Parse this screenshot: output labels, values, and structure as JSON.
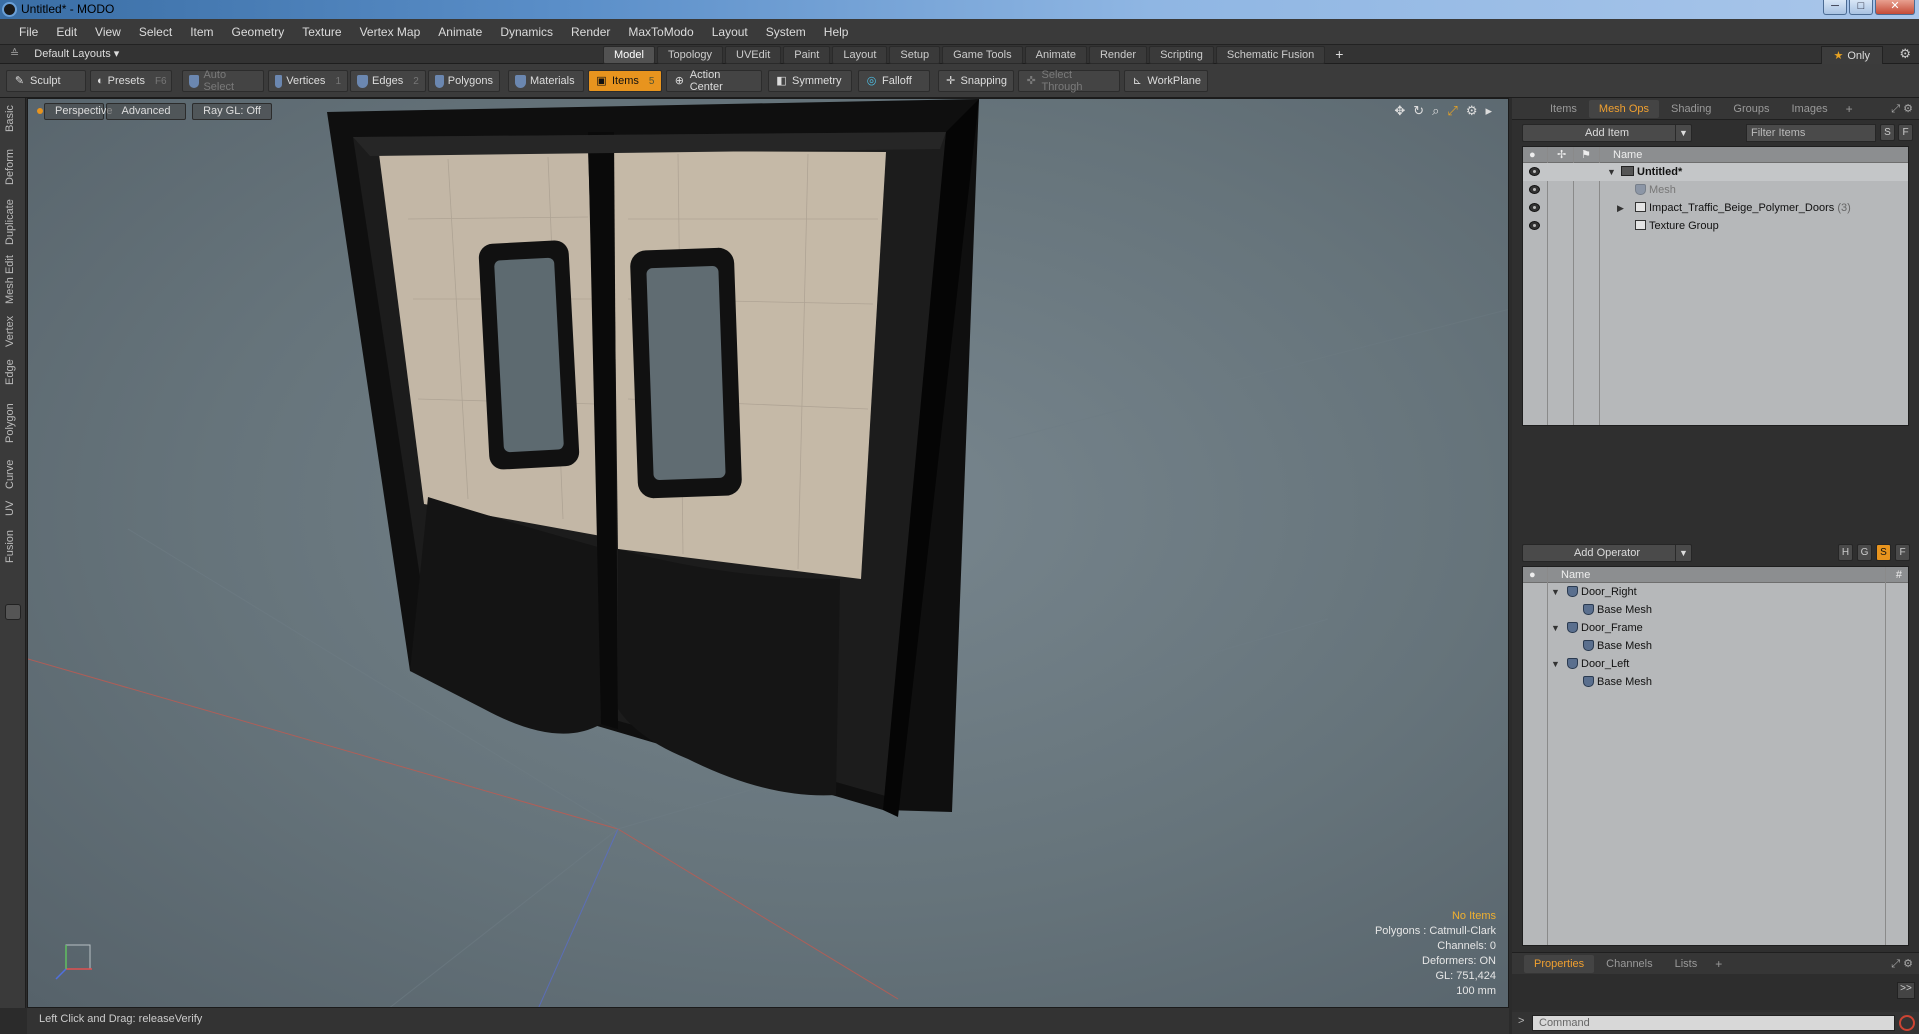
{
  "window": {
    "title": "Untitled* - MODO",
    "controls": [
      "─",
      "□",
      "✕"
    ]
  },
  "menubar": {
    "items": [
      "File",
      "Edit",
      "View",
      "Select",
      "Item",
      "Geometry",
      "Texture",
      "Vertex Map",
      "Animate",
      "Dynamics",
      "Render",
      "MaxToModo",
      "Layout",
      "System",
      "Help"
    ]
  },
  "layoutbar": {
    "layout_name": "Default Layouts ▾",
    "tabs": [
      "Model",
      "Topology",
      "UVEdit",
      "Paint",
      "Layout",
      "Setup",
      "Game Tools",
      "Animate",
      "Render",
      "Scripting",
      "Schematic Fusion"
    ],
    "active_tab": "Model",
    "add_tab": "+",
    "only_label": "Only"
  },
  "toolbar": {
    "sculpt": "Sculpt",
    "presets": "Presets",
    "presets_key": "F6",
    "auto_select": "Auto Select",
    "vertices": "Vertices",
    "vertices_count": "1",
    "edges": "Edges",
    "edges_count": "2",
    "polygons": "Polygons",
    "materials": "Materials",
    "items": "Items",
    "items_count": "5",
    "action_center": "Action Center",
    "symmetry": "Symmetry",
    "falloff": "Falloff",
    "snapping": "Snapping",
    "select_through": "Select Through",
    "workplane": "WorkPlane"
  },
  "left_tabs": [
    "Basic",
    "Deform",
    "Duplicate",
    "Mesh Edit",
    "Vertex",
    "Edge",
    "Polygon",
    "Curve",
    "UV",
    "Fusion"
  ],
  "viewport": {
    "view": "Perspective",
    "shading": "Advanced",
    "raygl": "Ray GL: Off",
    "info": {
      "selection": "No Items",
      "polygons": "Polygons : Catmull-Clark",
      "channels": "Channels: 0",
      "deformers": "Deformers: ON",
      "gl": "GL: 751,424",
      "grid": "100 mm"
    }
  },
  "statusbar": {
    "text": "Left Click and Drag:   releaseVerify"
  },
  "items_panel": {
    "tabs": [
      "Items",
      "Mesh Ops",
      "Shading",
      "Groups",
      "Images"
    ],
    "active_tab": "Mesh Ops",
    "add_item": "Add Item",
    "filter_placeholder": "Filter Items",
    "btn_s": "S",
    "btn_f": "F",
    "col_name": "Name",
    "rows": [
      {
        "label": "Untitled*"
      },
      {
        "label": "Mesh"
      },
      {
        "label": "Impact_Traffic_Beige_Polymer_Doors",
        "count": "(3)"
      },
      {
        "label": "Texture Group"
      }
    ]
  },
  "meshops_panel": {
    "add_operator": "Add Operator",
    "btn_h": "H",
    "btn_g": "G",
    "btn_s": "S",
    "btn_f": "F",
    "col_name": "Name",
    "col_hash": "#",
    "rows": [
      {
        "label": "Door_Right"
      },
      {
        "label": "Base Mesh"
      },
      {
        "label": "Door_Frame"
      },
      {
        "label": "Base Mesh"
      },
      {
        "label": "Door_Left"
      },
      {
        "label": "Base Mesh"
      }
    ]
  },
  "bottom_panel": {
    "tabs": [
      "Properties",
      "Channels",
      "Lists"
    ],
    "active_tab": "Properties",
    "command_placeholder": "Command",
    "expand": ">>"
  },
  "colors": {
    "accent": "#e8941e",
    "viewport_bg": "#66747b",
    "door_panel": "#c4b8a6",
    "door_frame": "#101010"
  }
}
